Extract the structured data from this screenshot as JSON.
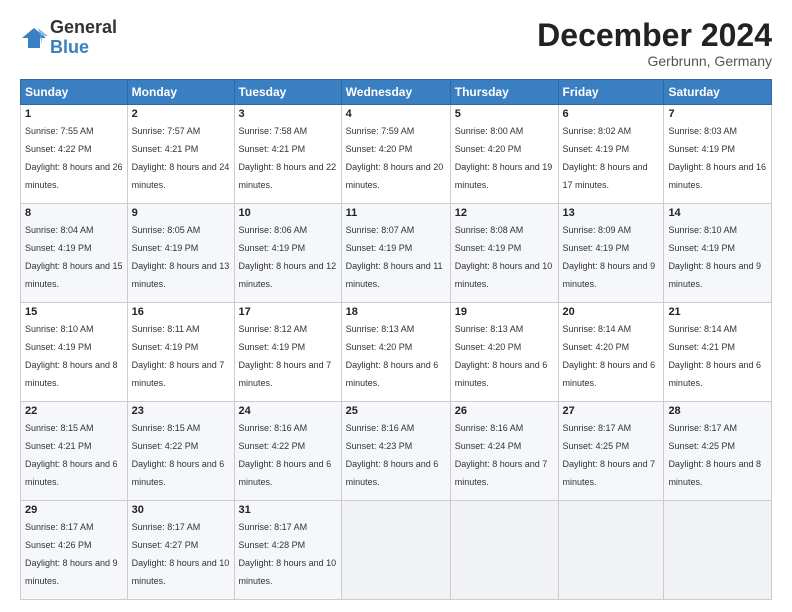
{
  "logo": {
    "general": "General",
    "blue": "Blue"
  },
  "header": {
    "month": "December 2024",
    "location": "Gerbrunn, Germany"
  },
  "weekdays": [
    "Sunday",
    "Monday",
    "Tuesday",
    "Wednesday",
    "Thursday",
    "Friday",
    "Saturday"
  ],
  "weeks": [
    [
      {
        "day": "1",
        "sunrise": "Sunrise: 7:55 AM",
        "sunset": "Sunset: 4:22 PM",
        "daylight": "Daylight: 8 hours and 26 minutes."
      },
      {
        "day": "2",
        "sunrise": "Sunrise: 7:57 AM",
        "sunset": "Sunset: 4:21 PM",
        "daylight": "Daylight: 8 hours and 24 minutes."
      },
      {
        "day": "3",
        "sunrise": "Sunrise: 7:58 AM",
        "sunset": "Sunset: 4:21 PM",
        "daylight": "Daylight: 8 hours and 22 minutes."
      },
      {
        "day": "4",
        "sunrise": "Sunrise: 7:59 AM",
        "sunset": "Sunset: 4:20 PM",
        "daylight": "Daylight: 8 hours and 20 minutes."
      },
      {
        "day": "5",
        "sunrise": "Sunrise: 8:00 AM",
        "sunset": "Sunset: 4:20 PM",
        "daylight": "Daylight: 8 hours and 19 minutes."
      },
      {
        "day": "6",
        "sunrise": "Sunrise: 8:02 AM",
        "sunset": "Sunset: 4:19 PM",
        "daylight": "Daylight: 8 hours and 17 minutes."
      },
      {
        "day": "7",
        "sunrise": "Sunrise: 8:03 AM",
        "sunset": "Sunset: 4:19 PM",
        "daylight": "Daylight: 8 hours and 16 minutes."
      }
    ],
    [
      {
        "day": "8",
        "sunrise": "Sunrise: 8:04 AM",
        "sunset": "Sunset: 4:19 PM",
        "daylight": "Daylight: 8 hours and 15 minutes."
      },
      {
        "day": "9",
        "sunrise": "Sunrise: 8:05 AM",
        "sunset": "Sunset: 4:19 PM",
        "daylight": "Daylight: 8 hours and 13 minutes."
      },
      {
        "day": "10",
        "sunrise": "Sunrise: 8:06 AM",
        "sunset": "Sunset: 4:19 PM",
        "daylight": "Daylight: 8 hours and 12 minutes."
      },
      {
        "day": "11",
        "sunrise": "Sunrise: 8:07 AM",
        "sunset": "Sunset: 4:19 PM",
        "daylight": "Daylight: 8 hours and 11 minutes."
      },
      {
        "day": "12",
        "sunrise": "Sunrise: 8:08 AM",
        "sunset": "Sunset: 4:19 PM",
        "daylight": "Daylight: 8 hours and 10 minutes."
      },
      {
        "day": "13",
        "sunrise": "Sunrise: 8:09 AM",
        "sunset": "Sunset: 4:19 PM",
        "daylight": "Daylight: 8 hours and 9 minutes."
      },
      {
        "day": "14",
        "sunrise": "Sunrise: 8:10 AM",
        "sunset": "Sunset: 4:19 PM",
        "daylight": "Daylight: 8 hours and 9 minutes."
      }
    ],
    [
      {
        "day": "15",
        "sunrise": "Sunrise: 8:10 AM",
        "sunset": "Sunset: 4:19 PM",
        "daylight": "Daylight: 8 hours and 8 minutes."
      },
      {
        "day": "16",
        "sunrise": "Sunrise: 8:11 AM",
        "sunset": "Sunset: 4:19 PM",
        "daylight": "Daylight: 8 hours and 7 minutes."
      },
      {
        "day": "17",
        "sunrise": "Sunrise: 8:12 AM",
        "sunset": "Sunset: 4:19 PM",
        "daylight": "Daylight: 8 hours and 7 minutes."
      },
      {
        "day": "18",
        "sunrise": "Sunrise: 8:13 AM",
        "sunset": "Sunset: 4:20 PM",
        "daylight": "Daylight: 8 hours and 6 minutes."
      },
      {
        "day": "19",
        "sunrise": "Sunrise: 8:13 AM",
        "sunset": "Sunset: 4:20 PM",
        "daylight": "Daylight: 8 hours and 6 minutes."
      },
      {
        "day": "20",
        "sunrise": "Sunrise: 8:14 AM",
        "sunset": "Sunset: 4:20 PM",
        "daylight": "Daylight: 8 hours and 6 minutes."
      },
      {
        "day": "21",
        "sunrise": "Sunrise: 8:14 AM",
        "sunset": "Sunset: 4:21 PM",
        "daylight": "Daylight: 8 hours and 6 minutes."
      }
    ],
    [
      {
        "day": "22",
        "sunrise": "Sunrise: 8:15 AM",
        "sunset": "Sunset: 4:21 PM",
        "daylight": "Daylight: 8 hours and 6 minutes."
      },
      {
        "day": "23",
        "sunrise": "Sunrise: 8:15 AM",
        "sunset": "Sunset: 4:22 PM",
        "daylight": "Daylight: 8 hours and 6 minutes."
      },
      {
        "day": "24",
        "sunrise": "Sunrise: 8:16 AM",
        "sunset": "Sunset: 4:22 PM",
        "daylight": "Daylight: 8 hours and 6 minutes."
      },
      {
        "day": "25",
        "sunrise": "Sunrise: 8:16 AM",
        "sunset": "Sunset: 4:23 PM",
        "daylight": "Daylight: 8 hours and 6 minutes."
      },
      {
        "day": "26",
        "sunrise": "Sunrise: 8:16 AM",
        "sunset": "Sunset: 4:24 PM",
        "daylight": "Daylight: 8 hours and 7 minutes."
      },
      {
        "day": "27",
        "sunrise": "Sunrise: 8:17 AM",
        "sunset": "Sunset: 4:25 PM",
        "daylight": "Daylight: 8 hours and 7 minutes."
      },
      {
        "day": "28",
        "sunrise": "Sunrise: 8:17 AM",
        "sunset": "Sunset: 4:25 PM",
        "daylight": "Daylight: 8 hours and 8 minutes."
      }
    ],
    [
      {
        "day": "29",
        "sunrise": "Sunrise: 8:17 AM",
        "sunset": "Sunset: 4:26 PM",
        "daylight": "Daylight: 8 hours and 9 minutes."
      },
      {
        "day": "30",
        "sunrise": "Sunrise: 8:17 AM",
        "sunset": "Sunset: 4:27 PM",
        "daylight": "Daylight: 8 hours and 10 minutes."
      },
      {
        "day": "31",
        "sunrise": "Sunrise: 8:17 AM",
        "sunset": "Sunset: 4:28 PM",
        "daylight": "Daylight: 8 hours and 10 minutes."
      },
      null,
      null,
      null,
      null
    ]
  ]
}
